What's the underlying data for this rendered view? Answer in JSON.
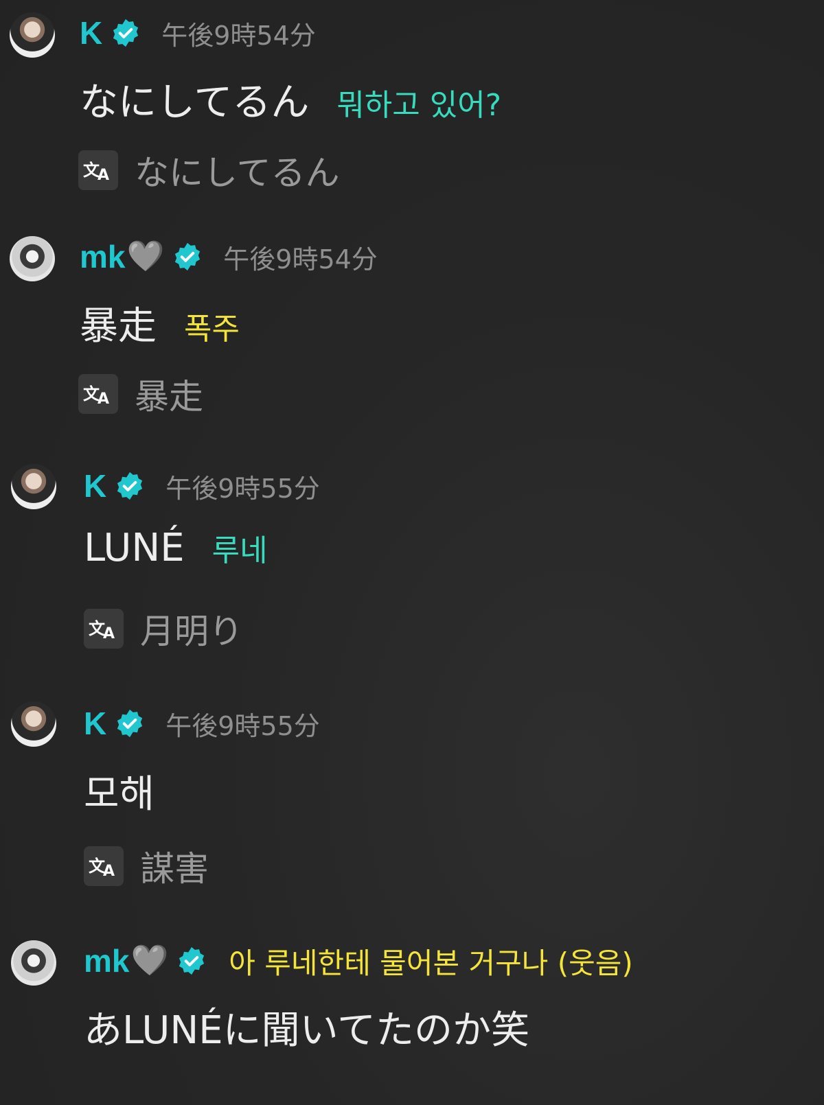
{
  "messages": [
    {
      "user": "K",
      "heart": "",
      "time": "午後9時54分",
      "header_gloss": "",
      "text": "なにしてるん",
      "gloss": "뭐하고 있어?",
      "translation": "なにしてるん"
    },
    {
      "user": "mk",
      "heart": "🩶",
      "time": "午後9時54分",
      "header_gloss": "",
      "text": "暴走",
      "gloss": "폭주",
      "translation": "暴走"
    },
    {
      "user": "K",
      "heart": "",
      "time": "午後9時55分",
      "header_gloss": "",
      "text": "LUNÉ",
      "gloss": "루네",
      "translation": "月明り"
    },
    {
      "user": "K",
      "heart": "",
      "time": "午後9時55分",
      "header_gloss": "",
      "text": "모해",
      "gloss": "",
      "translation": "謀害"
    },
    {
      "user": "mk",
      "heart": "🩶",
      "time": "",
      "header_gloss": "아 루네한테 물어본 거구나 (웃음)",
      "text": "あLUNÉに聞いてたのか笑",
      "gloss": "",
      "translation": ""
    }
  ],
  "icons": {
    "verified": "verified-badge-icon",
    "translate": "translate-icon",
    "heart": "grey-heart-icon"
  },
  "colors": {
    "username": "#21c7cf",
    "gloss_cyan": "#36dcbd",
    "gloss_yellow": "#f5e53a",
    "timestamp": "#8f8f8f",
    "background": "#262626"
  }
}
